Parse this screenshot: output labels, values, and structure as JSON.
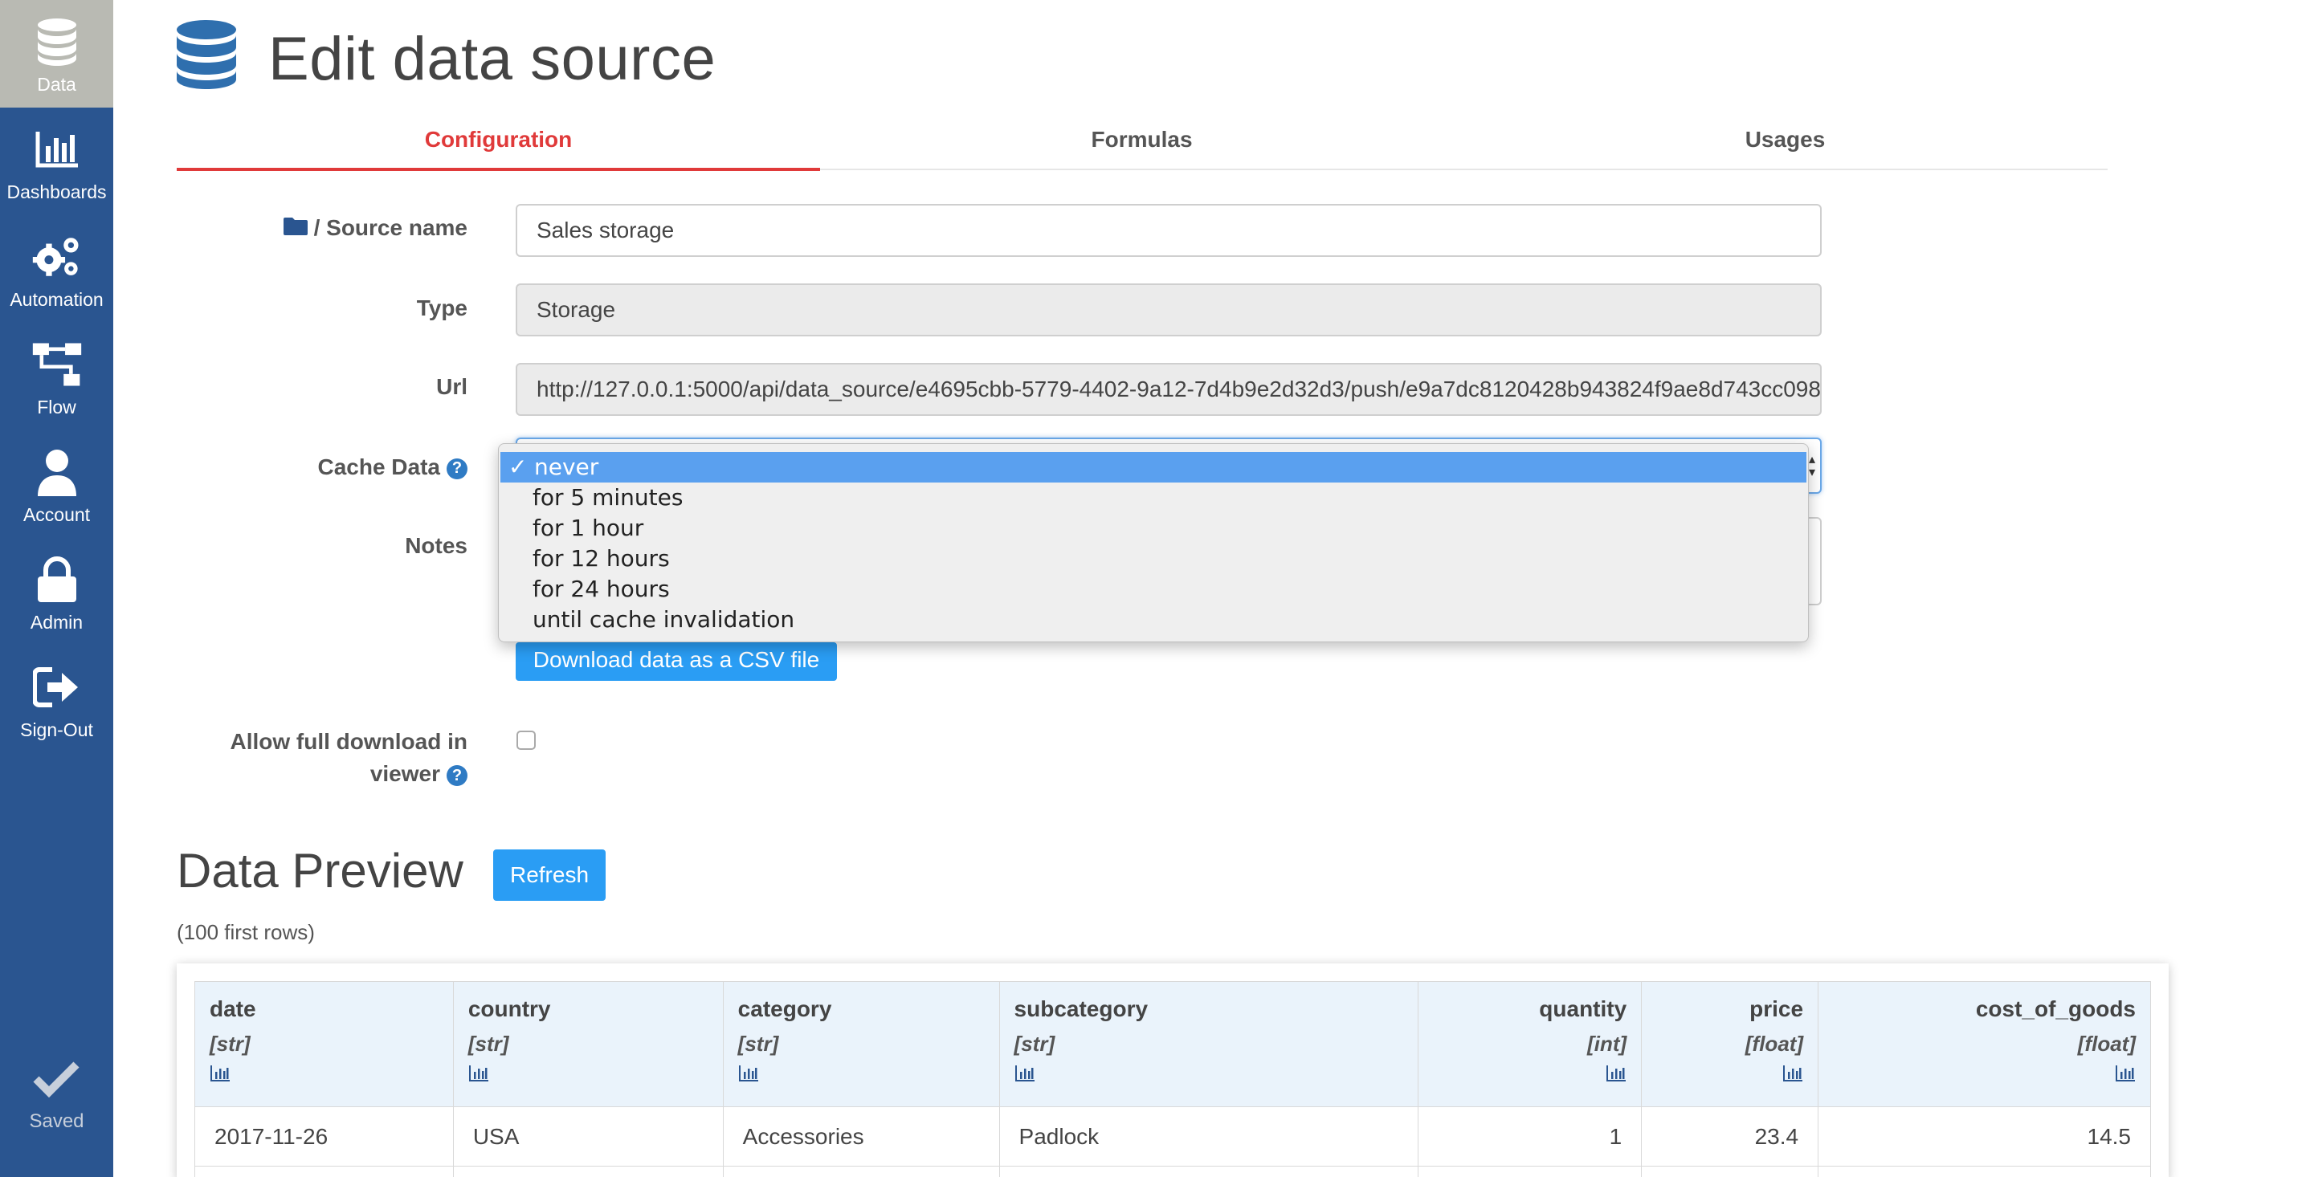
{
  "sidebar": {
    "items": [
      {
        "label": "Data",
        "icon": "database-icon"
      },
      {
        "label": "Dashboards",
        "icon": "bar-chart-icon"
      },
      {
        "label": "Automation",
        "icon": "gears-icon"
      },
      {
        "label": "Flow",
        "icon": "sitemap-icon"
      },
      {
        "label": "Account",
        "icon": "user-icon"
      },
      {
        "label": "Admin",
        "icon": "lock-icon"
      },
      {
        "label": "Sign-Out",
        "icon": "sign-out-icon"
      }
    ],
    "status": {
      "label": "Saved",
      "icon": "check-icon"
    }
  },
  "header": {
    "title": "Edit data source",
    "icon": "database-icon"
  },
  "tabs": [
    {
      "label": "Configuration",
      "active": true
    },
    {
      "label": "Formulas",
      "active": false
    },
    {
      "label": "Usages",
      "active": false
    }
  ],
  "form": {
    "source_name": {
      "label": "/ Source name",
      "value": "Sales storage",
      "icon": "folder-icon"
    },
    "type": {
      "label": "Type",
      "value": "Storage"
    },
    "url": {
      "label": "Url",
      "value": "http://127.0.0.1:5000/api/data_source/e4695cbb-5779-4402-9a12-7d4b9e2d32d3/push/e9a7dc8120428b943824f9ae8d743cc098"
    },
    "cache_data": {
      "label": "Cache Data",
      "selected": "never",
      "options": [
        "never",
        "for 5 minutes",
        "for 1 hour",
        "for 12 hours",
        "for 24 hours",
        "until cache invalidation"
      ]
    },
    "notes": {
      "label": "Notes",
      "value": ""
    },
    "download_button": "Download data as a CSV file",
    "allow_full_download": {
      "label_line1": "Allow full download in",
      "label_line2": "viewer",
      "checked": false
    }
  },
  "preview": {
    "title": "Data Preview",
    "refresh_button": "Refresh",
    "subtitle": "(100 first rows)",
    "columns": [
      {
        "name": "date",
        "type": "[str]",
        "align": "left"
      },
      {
        "name": "country",
        "type": "[str]",
        "align": "left"
      },
      {
        "name": "category",
        "type": "[str]",
        "align": "left"
      },
      {
        "name": "subcategory",
        "type": "[str]",
        "align": "left"
      },
      {
        "name": "quantity",
        "type": "[int]",
        "align": "right"
      },
      {
        "name": "price",
        "type": "[float]",
        "align": "right"
      },
      {
        "name": "cost_of_goods",
        "type": "[float]",
        "align": "right"
      }
    ],
    "rows": [
      [
        "2017-11-26",
        "USA",
        "Accessories",
        "Padlock",
        "1",
        "23.4",
        "14.5"
      ]
    ]
  },
  "colors": {
    "sidebar": "#2a5590",
    "accent": "#e03a3a",
    "button": "#2a9df4",
    "dropdown_selected": "#5aa0ef"
  }
}
